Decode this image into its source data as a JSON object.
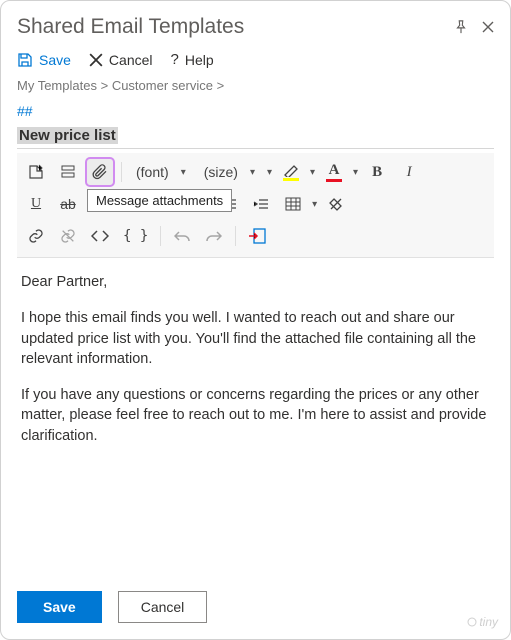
{
  "window": {
    "title": "Shared Email Templates"
  },
  "topToolbar": {
    "save": "Save",
    "cancel": "Cancel",
    "help": "Help"
  },
  "breadcrumb": {
    "root": "My Templates",
    "folder": "Customer service",
    "sep": ">"
  },
  "tag_marker": "##",
  "subject": "New price list",
  "editor": {
    "font_placeholder": "(font)",
    "size_placeholder": "(size)",
    "highlight_color": "#ffff00",
    "text_color": "#e81123",
    "tooltip_attachment": "Message attachments"
  },
  "email_body": {
    "p1": "Dear Partner,",
    "p2": "I hope this email finds you well. I wanted to reach out and share our updated price list with you. You'll find the attached file containing all the relevant information.",
    "p3": "If you have any questions or concerns regarding the prices or any other matter, please feel free to reach out to me. I'm here to assist and provide clarification."
  },
  "footer": {
    "save": "Save",
    "cancel": "Cancel"
  },
  "branding": {
    "tiny": "tiny"
  }
}
